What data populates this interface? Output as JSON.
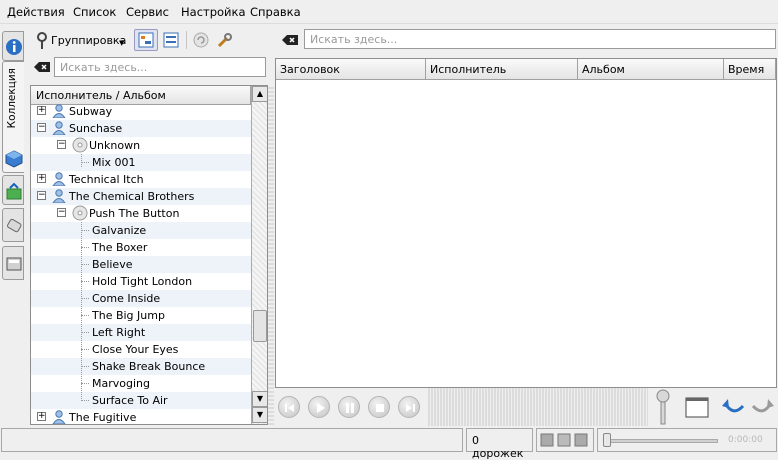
{
  "menu": [
    "Действия",
    "Список",
    "Сервис",
    "Настройка",
    "Справка"
  ],
  "sidebar": {
    "collection_tab": "Коллекция"
  },
  "toolbar": {
    "grouping_label": "Группировка"
  },
  "search": {
    "placeholder": "Искать здесь..."
  },
  "playlist_search": {
    "placeholder": "Искать здесь..."
  },
  "tree": {
    "header": "Исполнитель / Альбом",
    "rows": [
      {
        "text": "Subway",
        "kind": "artist"
      },
      {
        "text": "Sunchase",
        "kind": "artist"
      },
      {
        "text": "Unknown",
        "kind": "album"
      },
      {
        "text": "Mix 001",
        "kind": "track"
      },
      {
        "text": "Technical Itch",
        "kind": "artist"
      },
      {
        "text": "The Chemical Brothers",
        "kind": "artist"
      },
      {
        "text": "Push The Button",
        "kind": "album"
      },
      {
        "text": "Galvanize",
        "kind": "track"
      },
      {
        "text": "The Boxer",
        "kind": "track"
      },
      {
        "text": "Believe",
        "kind": "track"
      },
      {
        "text": "Hold Tight London",
        "kind": "track"
      },
      {
        "text": "Come Inside",
        "kind": "track"
      },
      {
        "text": "The Big Jump",
        "kind": "track"
      },
      {
        "text": "Left Right",
        "kind": "track"
      },
      {
        "text": "Close Your Eyes",
        "kind": "track"
      },
      {
        "text": "Shake Break Bounce",
        "kind": "track"
      },
      {
        "text": "Marvoging",
        "kind": "track"
      },
      {
        "text": "Surface To Air",
        "kind": "track"
      },
      {
        "text": "The Fugitive",
        "kind": "artist"
      }
    ]
  },
  "playlist": {
    "columns": [
      "Заголовок",
      "Исполнитель",
      "Альбом",
      "Время"
    ]
  },
  "status": {
    "tracks": "0 дорожек",
    "time": "0:00:00"
  }
}
